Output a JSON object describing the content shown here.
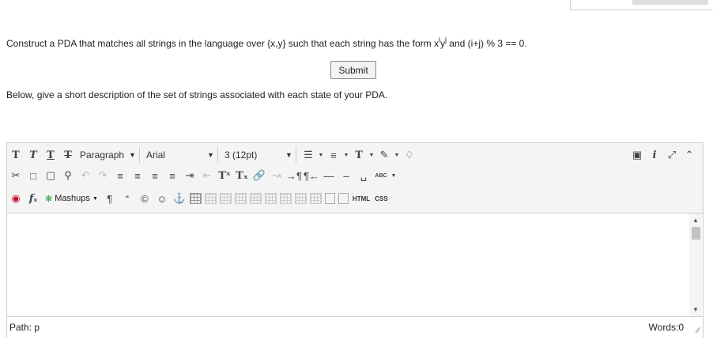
{
  "question": {
    "prefix": "Construct a PDA that matches all strings in the language over {x,y} such that each string has the form x",
    "sup1": "i",
    "mid": "y",
    "sup2": "j",
    "suffix": " and (i+j) % 3 == 0."
  },
  "submit_label": "Submit",
  "description_prompt": "Below, give a short description of the set of strings associated with each state of your PDA.",
  "toolbar": {
    "format_block": "Paragraph",
    "font_family": "Arial",
    "font_size": "3 (12pt)",
    "bold": "T",
    "italic": "T",
    "underline": "T",
    "strike": "T",
    "text_color": "T",
    "mashups_label": "Mashups",
    "html_label": "HTML",
    "css_label": "CSS",
    "spellcheck_label": "ABC",
    "info_label": "i"
  },
  "status": {
    "path": "Path: p",
    "words": "Words:0"
  }
}
